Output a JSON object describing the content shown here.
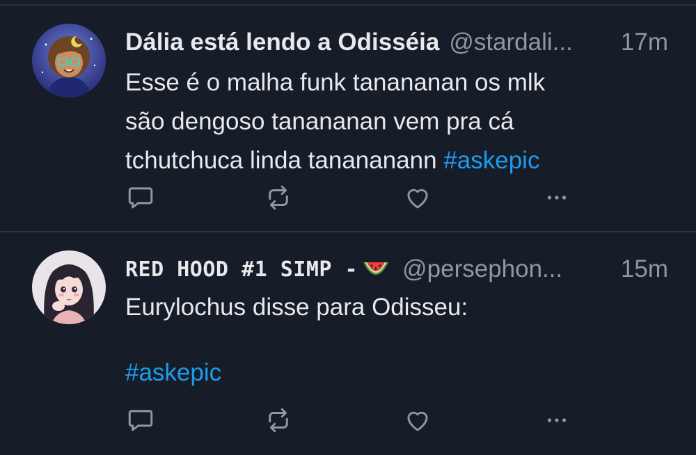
{
  "colors": {
    "background": "#161d29",
    "divider": "#2b3440",
    "text": "#e7e9ea",
    "muted": "#8b98a5",
    "hashtag": "#1d9bf0"
  },
  "tweets": [
    {
      "display_name": "Dália está lendo a Odisséia",
      "handle": "@stardali...",
      "time": "17m",
      "text_lines": [
        "Esse é o malha funk tanananan os mlk",
        "são dengoso tanananan vem pra cá",
        "tchutchuca linda tanananann "
      ],
      "hashtag": "#askepic",
      "avatar": "avatar-illustrated-girl-glasses-moon"
    },
    {
      "display_name": "RED HOOD #1 SIMP -",
      "emoji": "watermelon-icon",
      "handle": "@persephon...",
      "time": "15m",
      "text_line": "Eurylochus disse para Odisseu:",
      "hashtag": "#askepic",
      "avatar": "avatar-anime-girl-dark-hair"
    }
  ],
  "action_icons": [
    "reply-icon",
    "retweet-icon",
    "like-icon",
    "more-icon"
  ]
}
